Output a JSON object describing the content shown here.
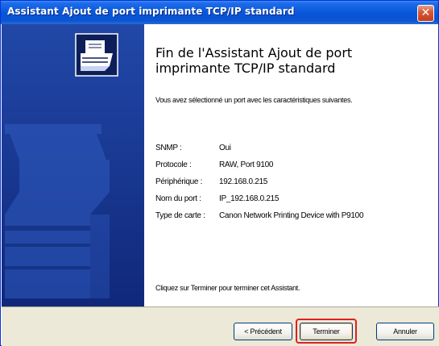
{
  "window": {
    "title": "Assistant Ajout de port imprimante TCP/IP standard",
    "close_glyph": "✕"
  },
  "heading": "Fin de l'Assistant Ajout de port imprimante TCP/IP standard",
  "intro": "Vous avez sélectionné un port avec les caractéristiques suivantes.",
  "details": [
    {
      "label": "SNMP :",
      "value": "Oui"
    },
    {
      "label": "Protocole :",
      "value": "RAW, Port 9100"
    },
    {
      "label": "Périphérique :",
      "value": "192.168.0.215"
    },
    {
      "label": "Nom du port :",
      "value": "IP_192.168.0.215"
    },
    {
      "label": "Type de carte :",
      "value": "Canon Network Printing Device with P9100"
    }
  ],
  "finish_text": "Cliquez sur Terminer pour terminer cet Assistant.",
  "buttons": {
    "back": "< Précédent",
    "finish": "Terminer",
    "cancel": "Annuler"
  },
  "colors": {
    "titlebar": "#0a5adf",
    "left_panel": "#1a3a8c",
    "highlight": "#e02020"
  },
  "icons": {
    "left_panel": "printer-wizard-illustration",
    "close": "close-icon"
  }
}
